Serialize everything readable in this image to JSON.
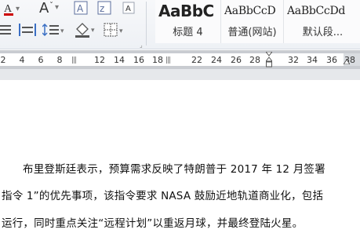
{
  "ribbon": {
    "styles": [
      {
        "sample": "AaBbC",
        "name": "标题 4"
      },
      {
        "sample": "AaBbCcD",
        "name": "普通(网站)"
      },
      {
        "sample": "AaBbCcDd",
        "name": "默认段..."
      }
    ],
    "icons": [
      "font-color-icon",
      "grow-font-icon",
      "character-border-icon",
      "replace-icon",
      "more-icon",
      "align-justify-icon",
      "distributed-icon",
      "line-spacing-icon",
      "shading-icon",
      "borders-icon"
    ]
  },
  "ruler": {
    "ticks": [
      "2",
      "4",
      "6",
      "8",
      "12",
      "14",
      "16",
      "18",
      "22",
      "24",
      "26",
      "28",
      "32",
      "34",
      "36",
      "38"
    ]
  },
  "document": {
    "paragraphs": [
      "布里登斯廷表示，预算需求反映了特朗普于 2017 年 12 月签署",
      "指令 1”的优先事项，该指令要求 NASA 鼓励近地轨道商业化，包括",
      "运行，同时重点关注“远程计划”以重返月球，并最终登陆火星。"
    ]
  }
}
